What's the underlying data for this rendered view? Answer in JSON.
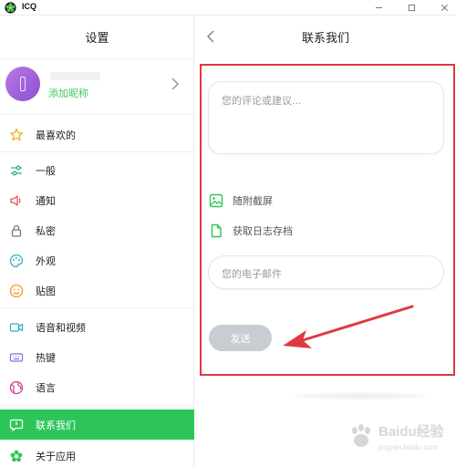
{
  "window": {
    "title": "ICQ",
    "controls": [
      "minimize-icon",
      "maximize-icon",
      "close-icon"
    ]
  },
  "sidebar": {
    "title": "设置",
    "profile": {
      "add_nickname": "添加昵称"
    },
    "items": [
      {
        "label": "最喜欢的",
        "icon": "star-icon"
      },
      {
        "label": "一般",
        "icon": "sliders-icon"
      },
      {
        "label": "通知",
        "icon": "speaker-icon"
      },
      {
        "label": "私密",
        "icon": "lock-icon"
      },
      {
        "label": "外观",
        "icon": "palette-icon"
      },
      {
        "label": "贴图",
        "icon": "sticker-icon"
      },
      {
        "label": "语音和视频",
        "icon": "video-icon"
      },
      {
        "label": "热键",
        "icon": "keyboard-icon"
      },
      {
        "label": "语言",
        "icon": "globe-icon"
      },
      {
        "label": "联系我们",
        "icon": "chat-icon",
        "active": true
      },
      {
        "label": "关于应用",
        "icon": "flower-icon"
      }
    ]
  },
  "main": {
    "title": "联系我们",
    "comment_placeholder": "您的评论或建议...",
    "attach_screenshot": "随附截屏",
    "get_log": "获取日志存档",
    "email_placeholder": "您的电子邮件",
    "send_label": "发送"
  },
  "watermark": {
    "brand": "Baidu经验",
    "url": "jingyan.baidu.com"
  },
  "colors": {
    "accent_green": "#2dc55a",
    "annotation_red": "#e0393f",
    "send_disabled": "#c8cdd3"
  }
}
